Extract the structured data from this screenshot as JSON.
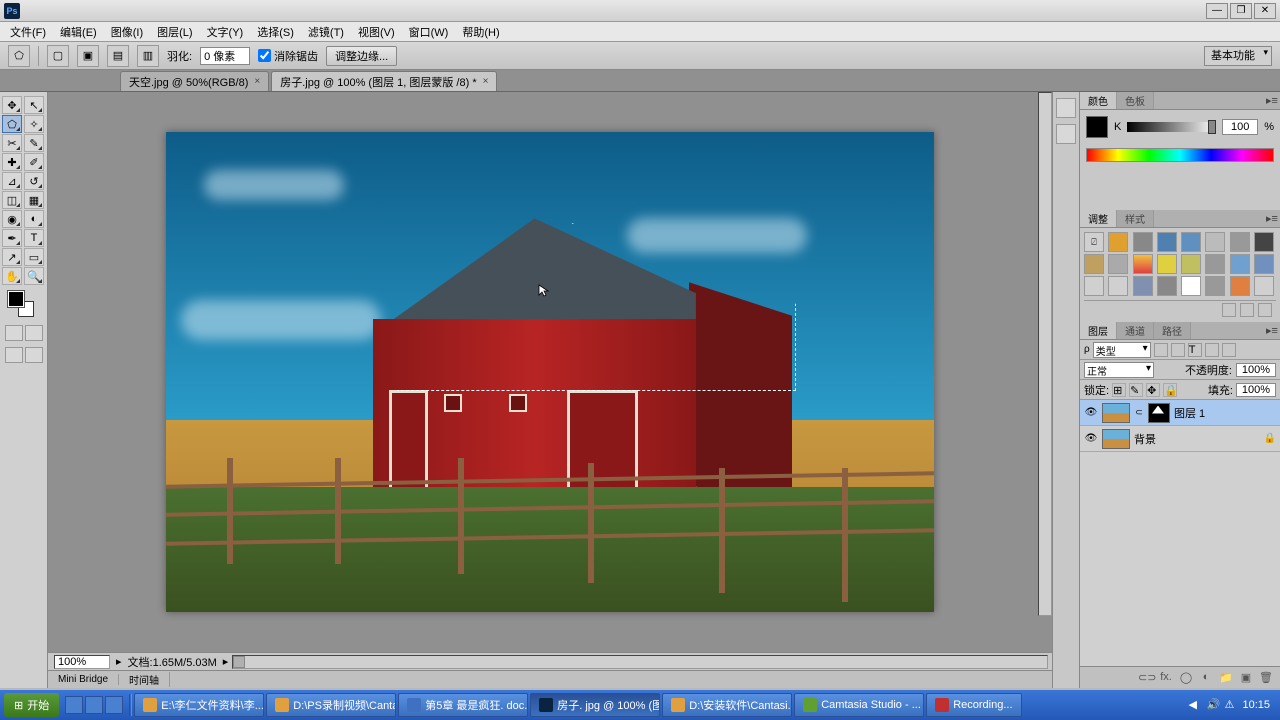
{
  "menubar": [
    "文件(F)",
    "编辑(E)",
    "图像(I)",
    "图层(L)",
    "文字(Y)",
    "选择(S)",
    "滤镜(T)",
    "视图(V)",
    "窗口(W)",
    "帮助(H)"
  ],
  "options": {
    "feather_label": "羽化:",
    "feather_value": "0 像素",
    "antialias": "消除锯齿",
    "refine": "调整边缘...",
    "workspace": "基本功能"
  },
  "tabs": [
    {
      "label": "天空.jpg @ 50%(RGB/8)",
      "active": false
    },
    {
      "label": "房子.jpg @ 100% (图层 1, 图层蒙版 /8) *",
      "active": true
    }
  ],
  "status": {
    "zoom": "100%",
    "doc": "文档:1.65M/5.03M"
  },
  "bottom_tabs": [
    "Mini Bridge",
    "时间轴"
  ],
  "color_panel": {
    "tab1": "颜色",
    "tab2": "色板",
    "mode": "K",
    "value": "100",
    "pct": "%"
  },
  "adjust_panel": {
    "tab1": "调整",
    "tab2": "样式"
  },
  "layers_panel": {
    "tab1": "图层",
    "tab2": "通道",
    "tab3": "路径",
    "filter": "类型",
    "blend": "正常",
    "opacity_label": "不透明度:",
    "opacity": "100%",
    "lock_label": "锁定:",
    "fill_label": "填充:",
    "fill": "100%",
    "items": [
      {
        "name": "图层 1",
        "selected": true,
        "mask": true
      },
      {
        "name": "背景",
        "selected": false,
        "locked": true
      }
    ]
  },
  "taskbar": {
    "start": "开始",
    "tasks": [
      "E:\\李仁文件资料\\李...",
      "D:\\PS录制视频\\Canta...",
      "第5章  最是疯狂. doc...",
      "房子. jpg @ 100% (图...",
      "D:\\安装软件\\Cantasi...",
      "Camtasia Studio - ...",
      "Recording..."
    ],
    "time": "10:15"
  }
}
